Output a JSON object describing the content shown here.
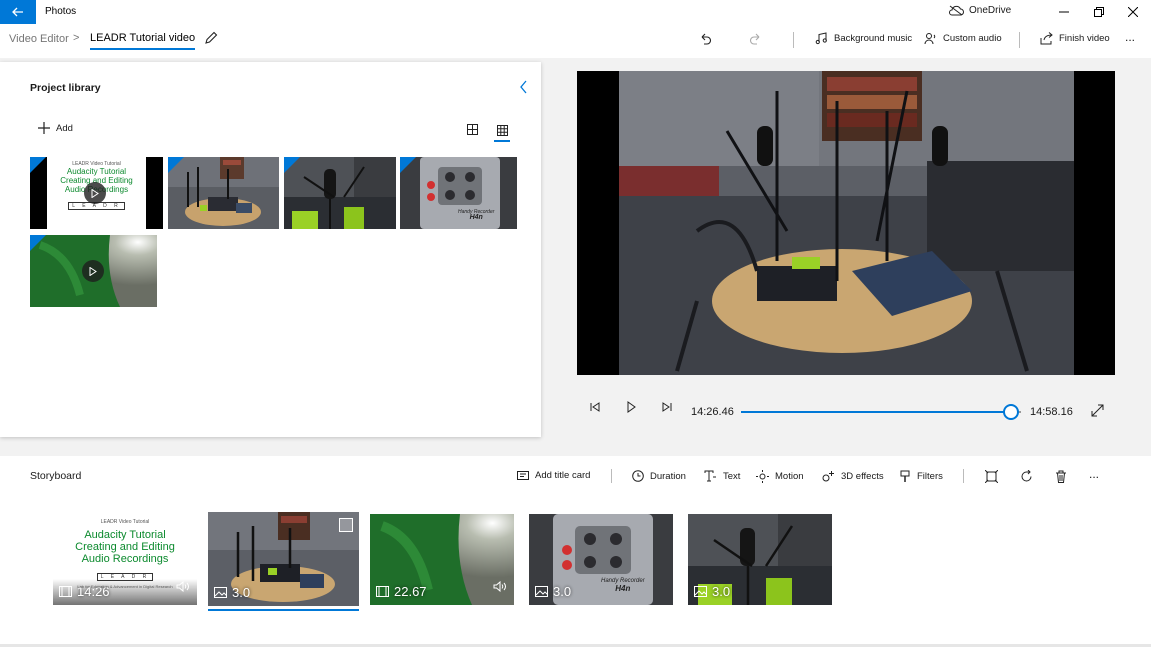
{
  "window": {
    "app_title": "Photos",
    "onedrive_label": "OneDrive"
  },
  "breadcrumb": {
    "root": "Video Editor",
    "separator": ">",
    "current": "LEADR Tutorial video"
  },
  "toolbar": {
    "background_music": "Background music",
    "custom_audio": "Custom audio",
    "finish_video": "Finish video",
    "more": "..."
  },
  "library": {
    "title": "Project library",
    "add_label": "Add"
  },
  "title_card": {
    "header": "LEADR Video Tutorial",
    "line1": "Audacity Tutorial",
    "line2": "Creating and Editing",
    "line3": "Audio Recordings",
    "logo": "L E A D R",
    "footer": "Lab for Education & Advancement in Digital Research"
  },
  "device_label": {
    "line1": "Handy Recorder",
    "line2": "H4n"
  },
  "player": {
    "current_time": "14:26.46",
    "total_time": "14:58.16",
    "progress_fraction": 0.964
  },
  "storyboard": {
    "title": "Storyboard",
    "add_title_card": "Add title card",
    "duration": "Duration",
    "text": "Text",
    "motion": "Motion",
    "effects_3d": "3D effects",
    "filters": "Filters",
    "more": "...",
    "clips": [
      {
        "duration": "14:26",
        "kind": "video"
      },
      {
        "duration": "3.0",
        "kind": "image"
      },
      {
        "duration": "22.67",
        "kind": "video"
      },
      {
        "duration": "3.0",
        "kind": "image"
      },
      {
        "duration": "3.0",
        "kind": "image"
      }
    ]
  },
  "colors": {
    "accent": "#0078d7",
    "title_card_text": "#0c8a2e"
  }
}
